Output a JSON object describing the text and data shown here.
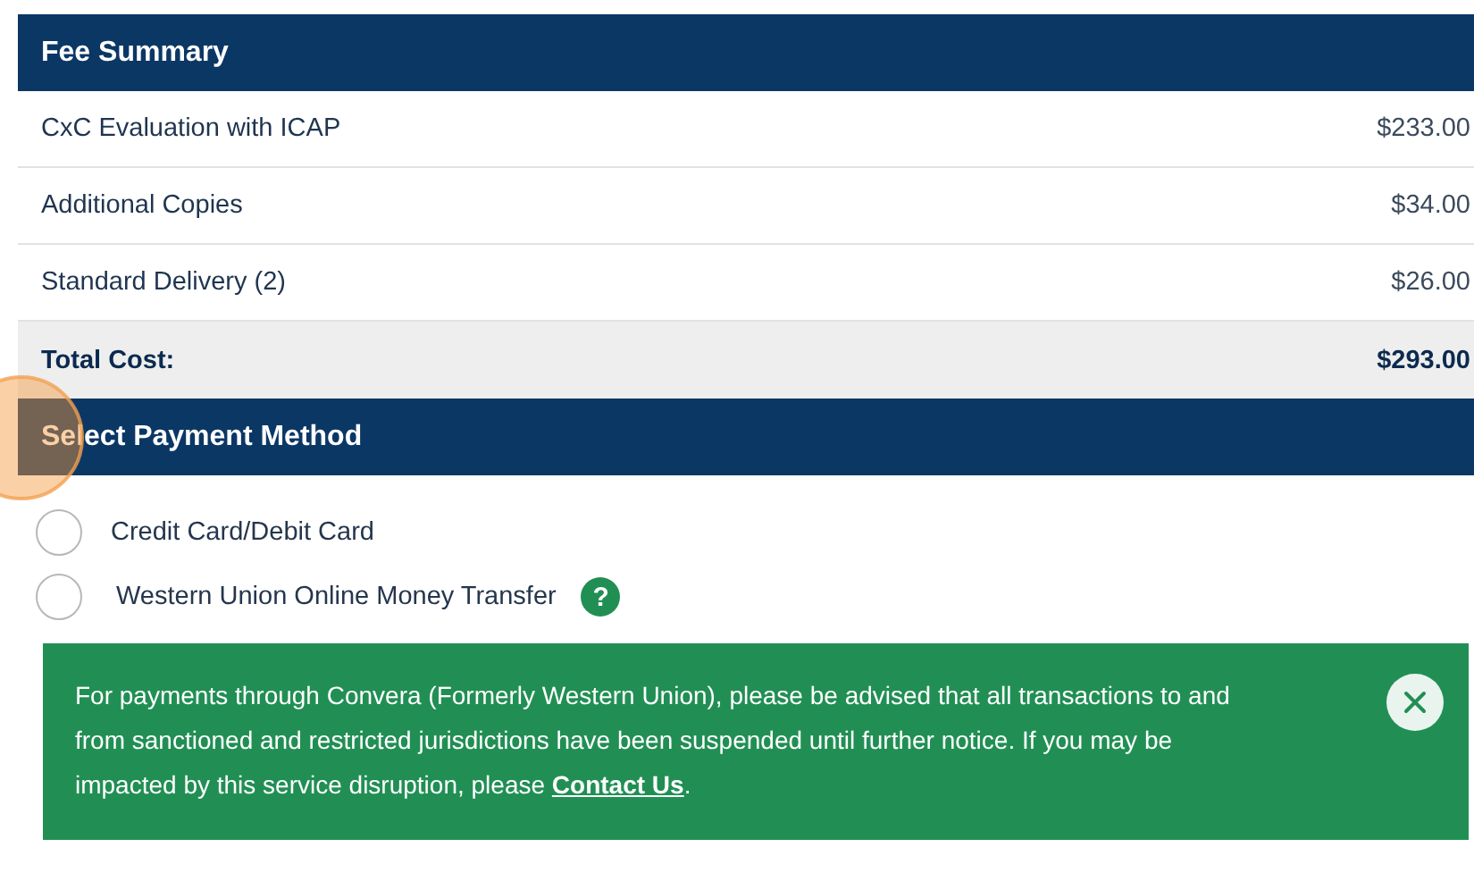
{
  "fee_summary": {
    "title": "Fee Summary",
    "rows": [
      {
        "label": "CxC Evaluation with ICAP",
        "amount": "$233.00"
      },
      {
        "label": "Additional Copies",
        "amount": "$34.00"
      },
      {
        "label": "Standard Delivery (2)",
        "amount": "$26.00"
      }
    ],
    "total": {
      "label": "Total Cost:",
      "amount": "$293.00"
    }
  },
  "payment_method": {
    "title": "Select Payment Method",
    "options": [
      {
        "label": "Credit Card/Debit Card",
        "selected": false
      },
      {
        "label": "Western Union Online Money Transfer",
        "selected": false,
        "help_icon": "?"
      }
    ],
    "notice": {
      "text_before": "For payments through Convera (Formerly Western Union), please be advised that all transactions to and from sanctioned and restricted jurisdictions have been suspended until further notice. If you may be impacted by this service disruption, please ",
      "link": "Contact Us",
      "text_after": "."
    }
  }
}
